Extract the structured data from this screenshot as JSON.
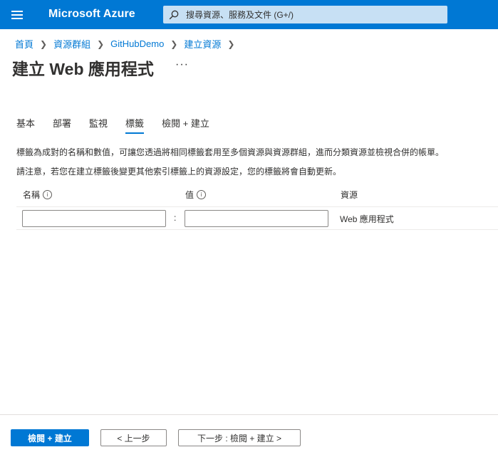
{
  "header": {
    "brand": "Microsoft Azure",
    "search_placeholder": "搜尋資源、服務及文件 (G+/)",
    "menu_icon": "hamburger-menu-icon",
    "search_icon": "search-icon",
    "accent_color": "#0078d4"
  },
  "breadcrumb": [
    "首頁",
    "資源群組",
    "GitHubDemo",
    "建立資源"
  ],
  "page": {
    "title": "建立 Web 應用程式",
    "more": "···"
  },
  "tabs": [
    {
      "label": "基本",
      "active": false
    },
    {
      "label": "部署",
      "active": false
    },
    {
      "label": "監視",
      "active": false
    },
    {
      "label": "標籤",
      "active": true
    },
    {
      "label": "檢閱 + 建立",
      "active": false
    }
  ],
  "description": [
    "標籤為成對的名稱和數值，可讓您透過將相同標籤套用至多個資源與資源群組，進而分類資源並檢視合併的帳單。",
    "請注意，若您在建立標籤後變更其他索引標籤上的資源設定，您的標籤將會自動更新。"
  ],
  "table": {
    "columns": {
      "name": "名稱",
      "value": "值",
      "resource": "資源"
    },
    "info_icon": "info-icon",
    "row": {
      "name_value": "",
      "separator": ":",
      "value_value": "",
      "resource": "Web 應用程式"
    }
  },
  "footer": {
    "review_create": "檢閱 + 建立",
    "previous": "< 上一步",
    "next": "下一步 : 檢閱 + 建立 >"
  }
}
